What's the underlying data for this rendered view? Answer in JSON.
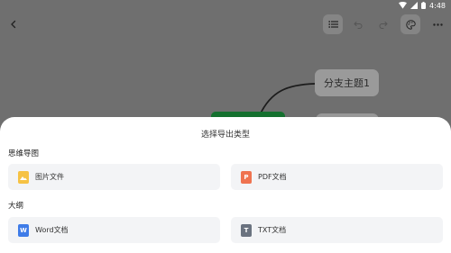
{
  "status_bar": {
    "time": "4:48"
  },
  "mind_map": {
    "branch_label": "分支主题1"
  },
  "export_sheet": {
    "title": "选择导出类型",
    "sections": [
      {
        "heading": "思维导图",
        "options": [
          {
            "label": "图片文件",
            "icon": "image-file-icon",
            "color": "#f6c244"
          },
          {
            "label": "PDF文档",
            "icon": "pdf-file-icon",
            "color": "#ef7350",
            "glyph": "P"
          }
        ]
      },
      {
        "heading": "大纲",
        "options": [
          {
            "label": "Word文档",
            "icon": "word-file-icon",
            "color": "#3f7ce8",
            "glyph": "W"
          },
          {
            "label": "TXT文档",
            "icon": "txt-file-icon",
            "color": "#6b7380",
            "glyph": "T"
          }
        ]
      }
    ]
  }
}
